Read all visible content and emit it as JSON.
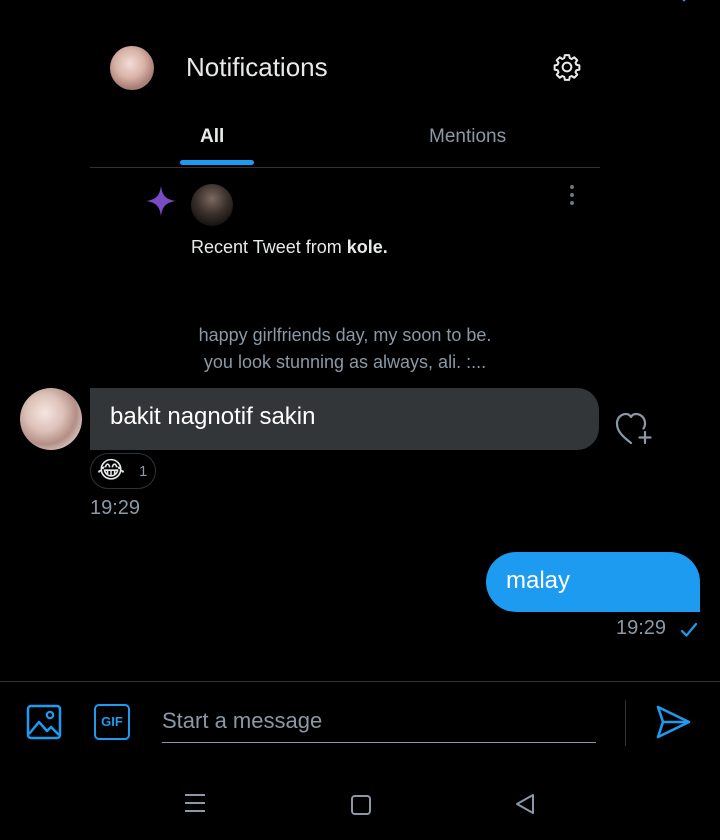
{
  "colors": {
    "accent": "#1d9bf0",
    "background": "#000000",
    "incoming_bubble": "#333639",
    "muted_text": "#8b98a5",
    "sparkle": "#794bc4"
  },
  "shared_card": {
    "title": "Notifications",
    "tabs": [
      {
        "label": "All",
        "active": true
      },
      {
        "label": "Mentions",
        "active": false
      }
    ],
    "recent_prefix": "Recent Tweet from ",
    "recent_user": "kole.",
    "tweet_line1": "happy girlfriends day, my soon to be.",
    "tweet_line2": "you look stunning as always, ali. :..."
  },
  "incoming": {
    "text": "bakit nagnotif sakin",
    "reaction_emoji": "😂",
    "reaction_count": "1",
    "time": "19:29"
  },
  "outgoing": {
    "text": "malay",
    "time": "19:29"
  },
  "composer": {
    "gif_label": "GIF",
    "placeholder": "Start a message"
  },
  "icons": {
    "gear": "gear-icon",
    "sparkle": "sparkle-icon",
    "more": "more-vertical-icon",
    "heart_plus": "heart-plus-icon",
    "image": "image-icon",
    "send": "send-icon",
    "check": "check-icon"
  }
}
